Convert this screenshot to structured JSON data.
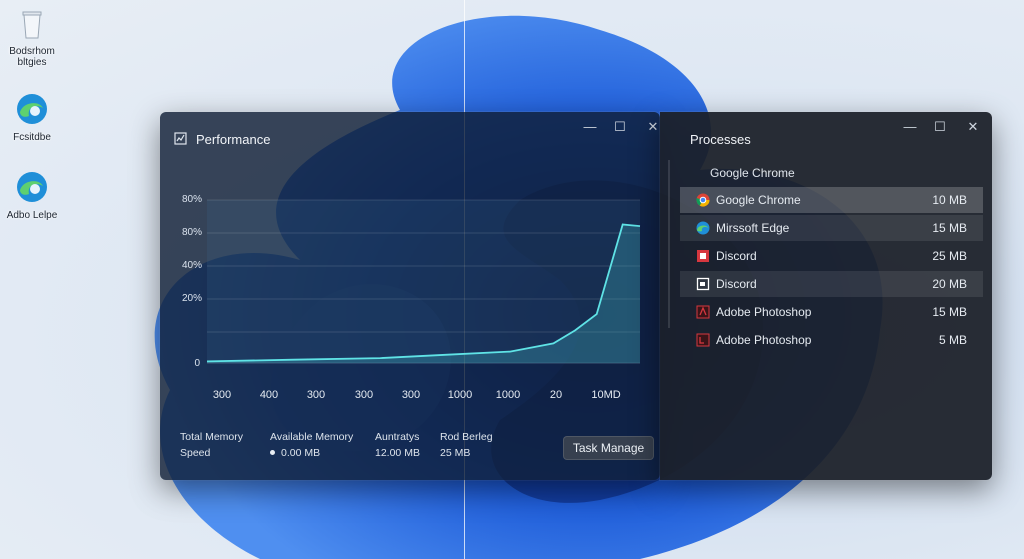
{
  "desktop": {
    "icons": [
      {
        "label": "Bodsrhom bltgies",
        "icon": "recycle-bin-icon"
      },
      {
        "label": "Fcsitdbe",
        "icon": "edge-icon"
      },
      {
        "label": "Adbo Lelpe",
        "icon": "edge-icon"
      }
    ]
  },
  "performance": {
    "title": "Performance",
    "y_ticks": [
      "80%",
      "80%",
      "40%",
      "20%",
      "0"
    ],
    "x_ticks": [
      "300",
      "400",
      "300",
      "300",
      "300",
      "1000",
      "1000",
      "20",
      "10MD"
    ],
    "stats": {
      "total_memory_label": "Total Memory",
      "speed_label": "Speed",
      "available_memory_label": "Available Memory",
      "available_memory_value": "0.00 MB",
      "auntrays_label": "Auntratys",
      "auntrays_value": "12.00 MB",
      "rod_label": "Rod Berleg",
      "rod_value": "25 MB"
    },
    "task_manager_button": "Task Manage"
  },
  "chart_data": {
    "type": "area",
    "title": "",
    "x": [
      "300",
      "400",
      "300",
      "300",
      "300",
      "1000",
      "1000",
      "20",
      "10MD"
    ],
    "series": [
      {
        "values": [
          1,
          2,
          3,
          5,
          7,
          12,
          20,
          30,
          85,
          84
        ]
      }
    ],
    "ylabel": "",
    "xlabel": "",
    "grid": true
  },
  "processes": {
    "title": "Processes",
    "subtitle": "Google Chrome",
    "rows": [
      {
        "name": "Google Chrome",
        "memory": "10 MB",
        "icon": "chrome-icon",
        "color": "#e8a13a"
      },
      {
        "name": "Mirssoft Edge",
        "memory": "15 MB",
        "icon": "edge-icon",
        "color": "#2fa8e0"
      },
      {
        "name": "Discord",
        "memory": "25 MB",
        "icon": "discord-icon",
        "color": "#d6373f"
      },
      {
        "name": "Discord",
        "memory": "20 MB",
        "icon": "discord-icon",
        "color": "#ffffff"
      },
      {
        "name": "Adobe Photoshop",
        "memory": "15 MB",
        "icon": "photoshop-icon",
        "color": "#d6373f"
      },
      {
        "name": "Adobe Photoshop",
        "memory": "5 MB",
        "icon": "photoshop-icon",
        "color": "#d6373f"
      }
    ]
  }
}
